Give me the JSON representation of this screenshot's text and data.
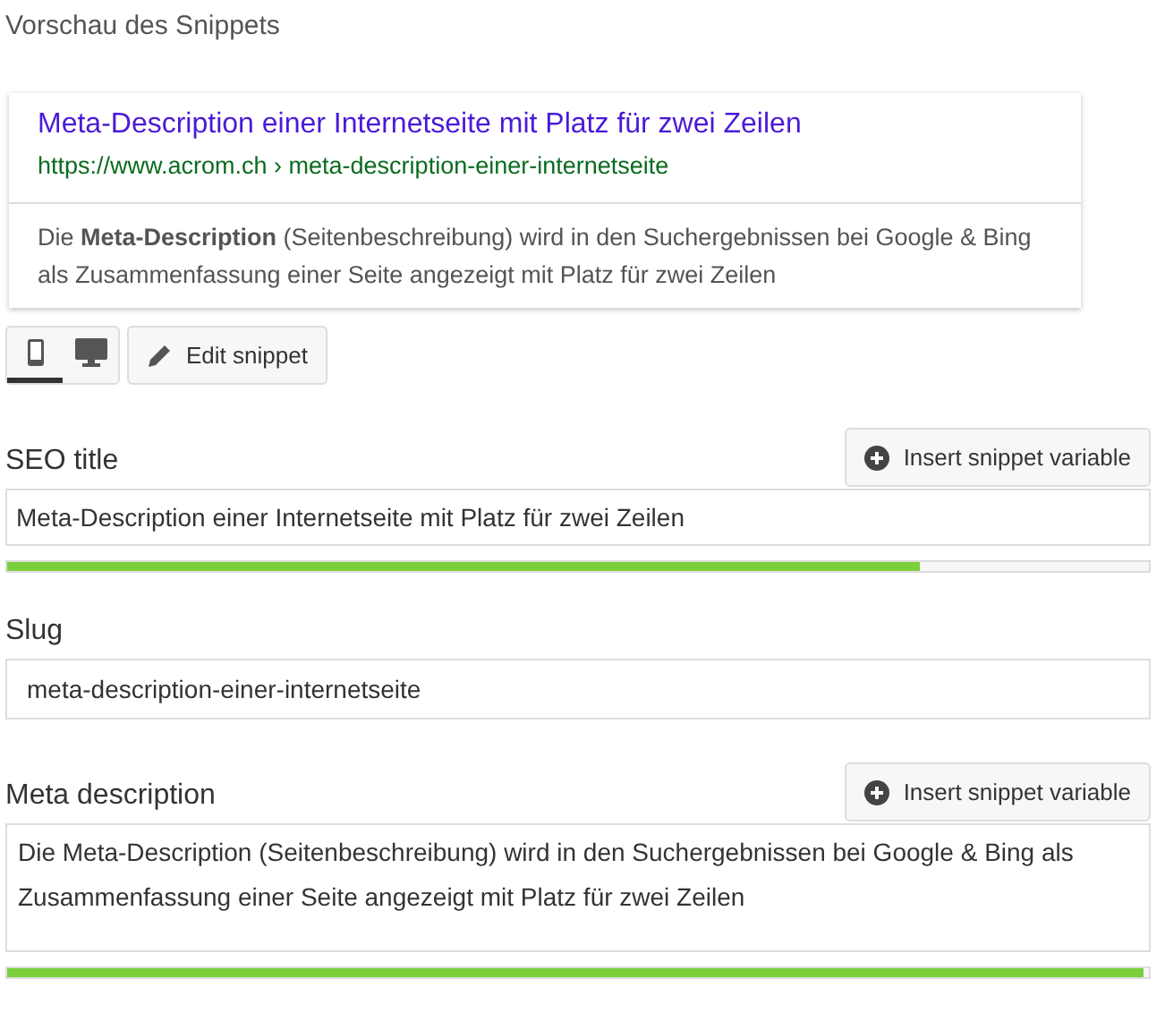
{
  "heading": "Vorschau des Snippets",
  "preview": {
    "title": "Meta-Description einer Internetseite mit Platz für zwei Zeilen",
    "url": "https://www.acrom.ch › meta-description-einer-internetseite",
    "description": "Die **Meta-Description** (Seitenbeschreibung) wird in den Suchergebnissen bei Google & Bing als Zusammenfassung einer Seite angezeigt mit Platz für zwei Zeilen"
  },
  "devices": [
    {
      "kind": "mobile",
      "selected": true
    },
    {
      "kind": "desktop",
      "selected": false
    }
  ],
  "edit_button": "Edit snippet",
  "fields": [
    {
      "kind": "input",
      "label": "SEO title",
      "button": "Insert snippet variable",
      "value": "Meta-Description einer Internetseite mit Platz für zwei Zeilen",
      "level": 0.8
    },
    {
      "kind": "input",
      "label": "Slug",
      "value": "meta-description-einer-internetseite"
    },
    {
      "kind": "textarea",
      "label": "Meta description",
      "button": "Insert snippet variable",
      "value": "Die Meta-Description (Seitenbeschreibung) wird in den Suchergebnissen bei Google & Bing als Zusammenfassung einer Seite angezeigt mit Platz für zwei Zeilen",
      "level": 0.995
    }
  ]
}
